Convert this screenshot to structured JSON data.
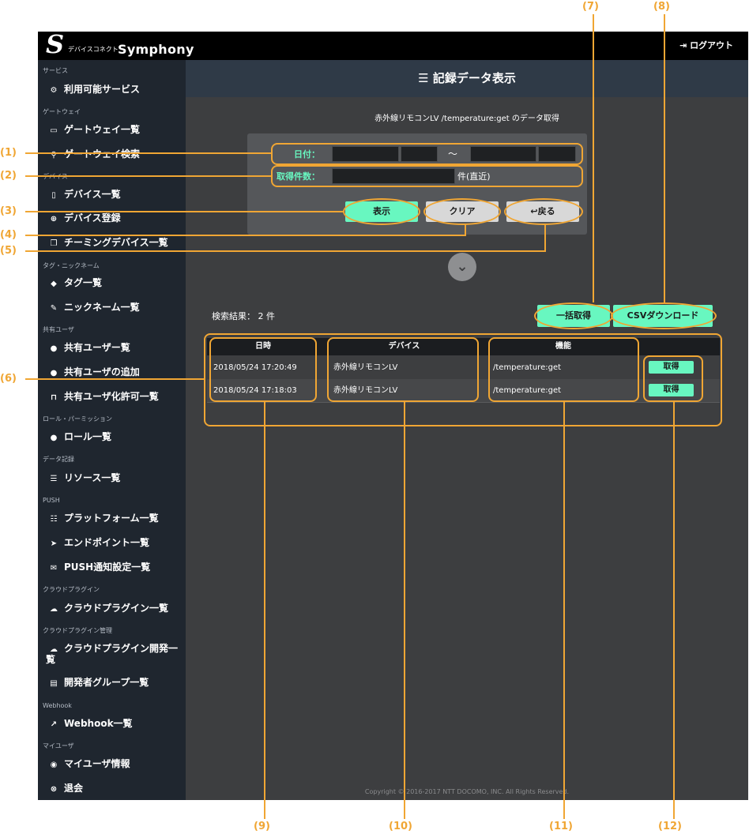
{
  "header": {
    "logo_letter": "S",
    "logo_sub": "デバイスコネクト",
    "logo_name": "Symphony",
    "logout_icon": "logout-icon",
    "logout_label": "ログアウト"
  },
  "sidebar": {
    "sections": [
      {
        "title": "サービス",
        "items": [
          {
            "label": "利用可能サービス",
            "icon": "gears-icon"
          }
        ]
      },
      {
        "title": "ゲートウェイ",
        "items": [
          {
            "label": "ゲートウェイ一覧",
            "icon": "drive-icon"
          },
          {
            "label": "ゲートウェイ検索",
            "icon": "search-icon"
          }
        ]
      },
      {
        "title": "デバイス",
        "items": [
          {
            "label": "デバイス一覧",
            "icon": "mobile-icon"
          },
          {
            "label": "デバイス登録",
            "icon": "plus-circle-icon"
          },
          {
            "label": "チーミングデバイス一覧",
            "icon": "clone-icon"
          }
        ]
      },
      {
        "title": "タグ・ニックネーム",
        "items": [
          {
            "label": "タグ一覧",
            "icon": "tags-icon"
          },
          {
            "label": "ニックネーム一覧",
            "icon": "pencil-icon"
          }
        ]
      },
      {
        "title": "共有ユーザ",
        "items": [
          {
            "label": "共有ユーザー覧",
            "icon": "user-icon"
          },
          {
            "label": "共有ユーザの追加",
            "icon": "user-plus-icon"
          },
          {
            "label": "共有ユーザ化許可一覧",
            "icon": "unlock-icon"
          }
        ]
      },
      {
        "title": "ロール・パーミッション",
        "items": [
          {
            "label": "ロール一覧",
            "icon": "users-icon"
          }
        ]
      },
      {
        "title": "データ記録",
        "items": [
          {
            "label": "リソース一覧",
            "icon": "database-icon"
          }
        ]
      },
      {
        "title": "PUSH",
        "items": [
          {
            "label": "プラットフォーム一覧",
            "icon": "server-icon"
          },
          {
            "label": "エンドポイント一覧",
            "icon": "paper-plane-icon"
          },
          {
            "label": "PUSH通知設定一覧",
            "icon": "envelope-icon"
          }
        ]
      },
      {
        "title": "クラウドプラグイン",
        "items": [
          {
            "label": "クラウドプラグイン一覧",
            "icon": "cloud-icon"
          }
        ]
      },
      {
        "title": "クラウドプラグイン管理",
        "items": [
          {
            "label": "クラウドプラグイン開発一",
            "label2": "覧",
            "icon": "cloud-upload-icon"
          },
          {
            "label": "開発者グループ一覧",
            "icon": "id-card-icon"
          }
        ]
      },
      {
        "title": "Webhook",
        "items": [
          {
            "label": "Webhook一覧",
            "icon": "share-icon"
          }
        ]
      },
      {
        "title": "マイユーザ",
        "items": [
          {
            "label": "マイユーザ情報",
            "icon": "user-circle-icon"
          },
          {
            "label": "退会",
            "icon": "times-circle-icon"
          }
        ]
      }
    ]
  },
  "main": {
    "title_icon": "database-icon",
    "title": "記録データ表示",
    "subtitle": "赤外線リモコンLV /temperature:get のデータ取得",
    "form": {
      "date_label": "日付：",
      "date_separator": "〜",
      "count_label": "取得件数：",
      "count_suffix": "件(直近)",
      "show_button": "表示",
      "clear_button": "クリア",
      "back_button": "↩戻る"
    },
    "results_label": "検索結果： 2 件",
    "bulk_button": "一括取得",
    "csv_button": "CSVダウンロード",
    "table": {
      "columns": [
        "日時",
        "デバイス",
        "機能"
      ],
      "rows": [
        {
          "datetime": "2018/05/24 17:20:49",
          "device": "赤外線リモコンLV",
          "function": "/temperature:get",
          "action": "取得"
        },
        {
          "datetime": "2018/05/24 17:18:03",
          "device": "赤外線リモコンLV",
          "function": "/temperature:get",
          "action": "取得"
        }
      ]
    },
    "footer": "Copyright © 2016-2017 NTT DOCOMO, INC. All Rights Reserved."
  },
  "annotations": {
    "n1": "(1)",
    "n2": "(2)",
    "n3": "(3)",
    "n4": "(4)",
    "n5": "(5)",
    "n6": "(6)",
    "n7": "(7)",
    "n8": "(8)",
    "n9": "(9)",
    "n10": "(10)",
    "n11": "(11)",
    "n12": "(12)"
  },
  "colors": {
    "accent": "#68f7c0",
    "annotation": "#f0a634",
    "sidebar": "#1f262f",
    "content": "#3d3e40"
  }
}
